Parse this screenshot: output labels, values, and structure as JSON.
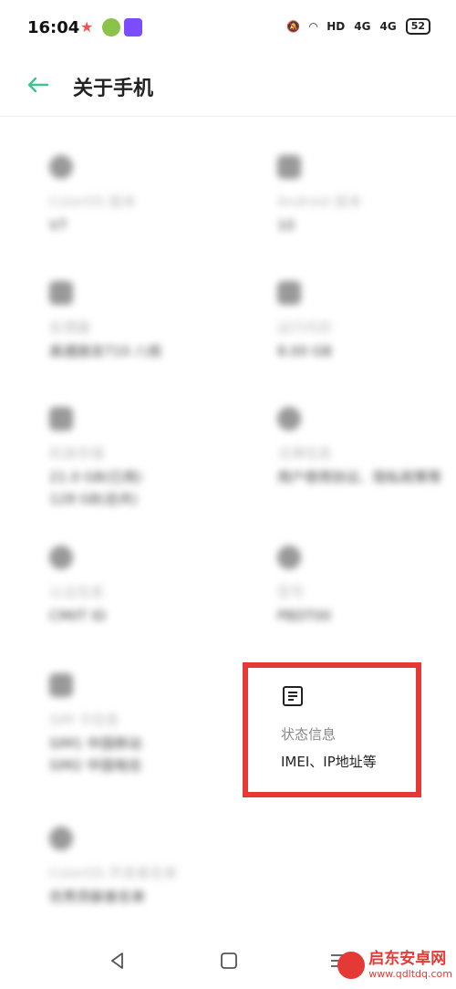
{
  "status_bar": {
    "time": "16:04",
    "network": "HD",
    "signal_1": "4G",
    "signal_2": "4G",
    "battery": "52"
  },
  "header": {
    "title": "关于手机"
  },
  "items": [
    {
      "label": "ColorOS 版本",
      "value": "V7"
    },
    {
      "label": "Android 版本",
      "value": "10"
    },
    {
      "label": "处理器",
      "value": "高通骁龙710 八核"
    },
    {
      "label": "运行内存",
      "value": "8.00 GB"
    },
    {
      "label": "机身存储",
      "value": "21.0 GB(已用)\n128 GB(总共)"
    },
    {
      "label": "法律信息",
      "value": "用户使用协议、隐私政策等"
    },
    {
      "label": "认证信息",
      "value": "CMIIT ID"
    },
    {
      "label": "型号",
      "value": "PBDT00"
    },
    {
      "label": "SIM 卡信息",
      "value": "SIM1 中国移动\nSIM2 中国电信"
    },
    {
      "label": "ColorOS 开发者名单",
      "value": "优秀贡献者名单"
    }
  ],
  "status_info": {
    "label": "状态信息",
    "value": "IMEI、IP地址等"
  },
  "watermark": {
    "text": "启东安卓网",
    "url": "www.qdltdq.com"
  }
}
